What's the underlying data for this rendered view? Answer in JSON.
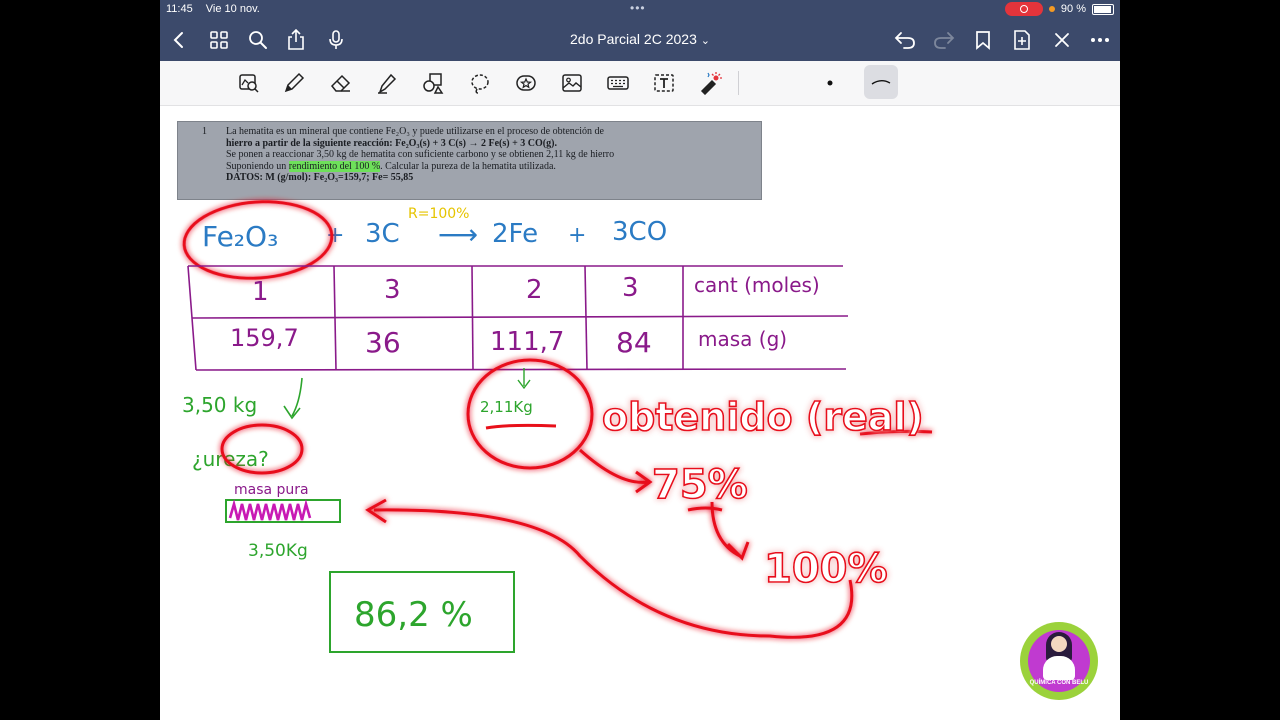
{
  "status": {
    "time": "11:45",
    "date": "Vie 10 nov.",
    "battery": "90 %"
  },
  "nav": {
    "title": "2do Parcial 2C 2023",
    "title_chevron": "⌄"
  },
  "toolbar": {
    "tools": [
      "lasso-zoom-icon",
      "pen-icon",
      "eraser-icon",
      "highlighter-icon",
      "shapes-icon",
      "lasso-icon",
      "sticker-icon",
      "image-icon",
      "keyboard-icon",
      "text-box-icon",
      "laser-pointer-icon"
    ],
    "active": "stroke-thin"
  },
  "problem": {
    "number": "1",
    "line1": "La hematita es un mineral que contiene Fe₂O₃ y puede utilizarse en el proceso de obtención de",
    "line2": "hierro a partir de la siguiente reacción:      Fe₂O₃(s) + 3 C(s) → 2 Fe(s) + 3 CO(g).",
    "line3": "Se ponen a reaccionar 3,50 kg de hematita con suficiente carbono y se obtienen 2,11 kg de hierro",
    "line4_pre": "Suponiendo un ",
    "line4_highlight": "rendimiento del 100 %",
    "line4_post": ". Calcular la pureza de la hematita utilizada.",
    "line5": "DATOS: M (g/mol): Fe₂O₃=159,7; Fe= 55,85"
  },
  "notes": {
    "eq_fe2o3": "Fe₂O₃",
    "eq_plus1": "+",
    "eq_3c": "3C",
    "eq_r": "R=100%",
    "eq_arrow": "⟶",
    "eq_2fe": "2Fe",
    "eq_plus2": "+",
    "eq_3co": "3CO",
    "row1": [
      "1",
      "3",
      "2",
      "3"
    ],
    "row1_label": "cant (moles)",
    "row2": [
      "159,7",
      "36",
      "111,7",
      "84"
    ],
    "row2_label": "masa (g)",
    "mass_given": "3,50 kg",
    "pureza": "¿ureza?",
    "masa_pura": "masa pura",
    "bar_label": "3,50Kg",
    "result": "86,2 %",
    "obtained_mass": "2,11Kg",
    "obtenido": "obtenido (real)",
    "p75": "75%",
    "p100": "100%"
  },
  "logo": {
    "text": "QUÍMICA CON BELU"
  },
  "colors": {
    "navbar": "#3c4a6b",
    "ink_blue": "#2b7bc4",
    "ink_purple": "#8a1a8a",
    "ink_green": "#2da52d",
    "ink_red": "#e8101a",
    "highlight": "#6ee05a"
  }
}
